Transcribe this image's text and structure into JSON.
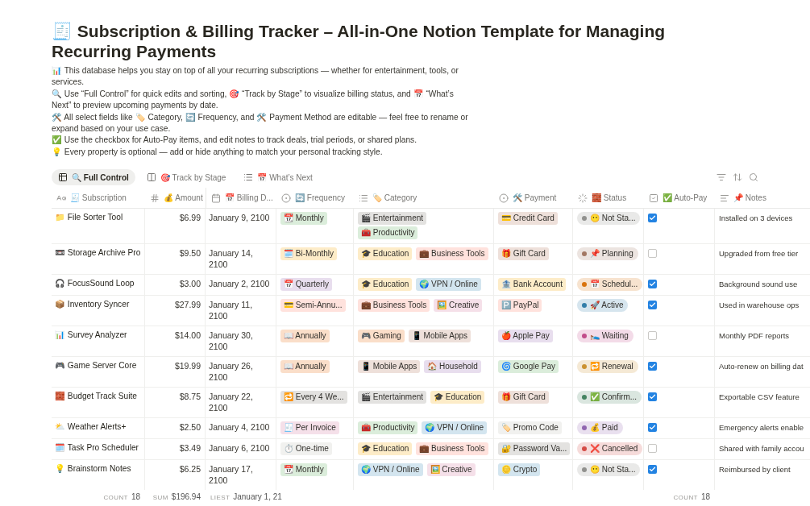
{
  "title": "🧾 Subscription & Billing Tracker – All-in-One Notion Template for Managing Recurring Payments",
  "description": [
    "📊 This database helps you stay on top of all your recurring subscriptions — whether for entertainment, tools, or services.",
    "🔍 Use “Full Control” for quick edits and sorting, 🎯 “Track by Stage” to visualize billing status, and 📅 “What’s Next” to preview upcoming payments by date.",
    "🛠️ All select fields like 🏷️ Category, 🔄 Frequency, and 🛠️ Payment Method are editable — feel free to rename or expand based on your use case.",
    "✅ Use the checkbox for Auto-Pay items, and edit notes to track deals, trial periods, or shared plans.",
    "💡 Every property is optional — add or hide anything to match your personal tracking style."
  ],
  "views": [
    {
      "kind": "table",
      "label": "🔍 Full Control",
      "selected": true
    },
    {
      "kind": "board",
      "label": "🎯 Track by Stage",
      "selected": false
    },
    {
      "kind": "list",
      "label": "📅 What’s Next",
      "selected": false
    }
  ],
  "columns": [
    {
      "kind": "text",
      "label": "🧾 Subscription"
    },
    {
      "kind": "number",
      "label": "💰 Amount"
    },
    {
      "kind": "date",
      "label": "📅 Billing D..."
    },
    {
      "kind": "select",
      "label": "🔄 Frequency"
    },
    {
      "kind": "multi",
      "label": "🏷️ Category"
    },
    {
      "kind": "select",
      "label": "🛠️ Payment"
    },
    {
      "kind": "status",
      "label": "🧱 Status"
    },
    {
      "kind": "checkbox",
      "label": "✅ Auto-Pay"
    },
    {
      "kind": "notes",
      "label": "📌 Notes"
    }
  ],
  "rows": [
    {
      "name": "📁 File Sorter Tool",
      "amount": "$6.99",
      "billing": "January 9, 2100",
      "frequency": {
        "label": "📆 Monthly",
        "color": "#dbeddb"
      },
      "categories": [
        {
          "label": "🎬 Entertainment",
          "color": "#e3e2e0"
        },
        {
          "label": "🧰 Productivity",
          "color": "#dbeddb"
        }
      ],
      "payment": {
        "label": "💳 Credit Card",
        "color": "#eee0da"
      },
      "status": {
        "label": "😶 Not Sta...",
        "color": "#91918e"
      },
      "auto_pay": true,
      "notes": "Installed on 3 devices"
    },
    {
      "name": "📼 Storage Archive Pro",
      "amount": "$9.50",
      "billing": "January 14, 2100",
      "frequency": {
        "label": "🗓️ Bi-Monthly",
        "color": "#fdecc8"
      },
      "categories": [
        {
          "label": "🎓 Education",
          "color": "#fdecc8"
        },
        {
          "label": "💼 Business Tools",
          "color": "#ffe2dd"
        }
      ],
      "payment": {
        "label": "🎁 Gift Card",
        "color": "#eee0da"
      },
      "status": {
        "label": "📌 Planning",
        "color": "#a27763"
      },
      "auto_pay": false,
      "notes": "Upgraded from free tier"
    },
    {
      "name": "🎧 FocusSound Loop",
      "amount": "$3.00",
      "billing": "January 2, 2100",
      "frequency": {
        "label": "📅 Quarterly",
        "color": "#e8deee"
      },
      "categories": [
        {
          "label": "🎓 Education",
          "color": "#fdecc8"
        },
        {
          "label": "🌍 VPN / Online",
          "color": "#d3e5ef"
        }
      ],
      "payment": {
        "label": "🏦 Bank Account",
        "color": "#fdecc8"
      },
      "status": {
        "label": "📅 Schedul...",
        "color": "#d9730d"
      },
      "auto_pay": true,
      "notes": "Background sound use"
    },
    {
      "name": "📦 Inventory Syncer",
      "amount": "$27.99",
      "billing": "January 11, 2100",
      "frequency": {
        "label": "💳 Semi-Annu...",
        "color": "#ffe2dd"
      },
      "categories": [
        {
          "label": "💼 Business Tools",
          "color": "#ffe2dd"
        },
        {
          "label": "🖼️ Creative",
          "color": "#f5e0e9"
        }
      ],
      "payment": {
        "label": "🅿️ PayPal",
        "color": "#ffe2dd"
      },
      "status": {
        "label": "🚀 Active",
        "color": "#337ea9"
      },
      "auto_pay": true,
      "notes": "Used in warehouse ops"
    },
    {
      "name": "📊 Survey Analyzer",
      "amount": "$14.00",
      "billing": "January 30, 2100",
      "frequency": {
        "label": "📖 Annually",
        "color": "#fadec9"
      },
      "categories": [
        {
          "label": "🎮 Gaming",
          "color": "#fadec9"
        },
        {
          "label": "📱 Mobile Apps",
          "color": "#eee0da"
        }
      ],
      "payment": {
        "label": "🍎 Apple Pay",
        "color": "#e8deee"
      },
      "status": {
        "label": "🛌 Waiting",
        "color": "#c14c8a"
      },
      "auto_pay": false,
      "notes": "Monthly PDF reports"
    },
    {
      "name": "🎮 Game Server Core",
      "amount": "$19.99",
      "billing": "January 26, 2100",
      "frequency": {
        "label": "📖 Annually",
        "color": "#fadec9"
      },
      "categories": [
        {
          "label": "📱 Mobile Apps",
          "color": "#eee0da"
        },
        {
          "label": "🏠 Household",
          "color": "#e8deee"
        }
      ],
      "payment": {
        "label": "🌀 Google Pay",
        "color": "#dbeddb"
      },
      "status": {
        "label": "🔁 Renewal",
        "color": "#cb912f"
      },
      "auto_pay": true,
      "notes": "Auto-renew on billing dat"
    },
    {
      "name": "🧱 Budget Track Suite",
      "amount": "$8.75",
      "billing": "January 22, 2100",
      "frequency": {
        "label": "🔁 Every 4 We...",
        "color": "#e3e2e0"
      },
      "categories": [
        {
          "label": "🎬 Entertainment",
          "color": "#e3e2e0"
        },
        {
          "label": "🎓 Education",
          "color": "#fdecc8"
        }
      ],
      "payment": {
        "label": "🎁 Gift Card",
        "color": "#eee0da"
      },
      "status": {
        "label": "✅ Confirm...",
        "color": "#448361"
      },
      "auto_pay": true,
      "notes": "Exportable CSV feature"
    },
    {
      "name": "⛅ Weather Alerts+",
      "amount": "$2.50",
      "billing": "January 4, 2100",
      "frequency": {
        "label": "🧾 Per Invoice",
        "color": "#f5e0e9"
      },
      "categories": [
        {
          "label": "🧰 Productivity",
          "color": "#dbeddb"
        },
        {
          "label": "🌍 VPN / Online",
          "color": "#d3e5ef"
        }
      ],
      "payment": {
        "label": "🏷️ Promo Code",
        "color": "#f1f1ef"
      },
      "status": {
        "label": "💰 Paid",
        "color": "#9065b0"
      },
      "auto_pay": true,
      "notes": "Emergency alerts enable"
    },
    {
      "name": "🗓️ Task Pro Scheduler",
      "amount": "$3.49",
      "billing": "January 6, 2100",
      "frequency": {
        "label": "⏱️ One-time",
        "color": "#f1f1ef"
      },
      "categories": [
        {
          "label": "🎓 Education",
          "color": "#fdecc8"
        },
        {
          "label": "💼 Business Tools",
          "color": "#ffe2dd"
        }
      ],
      "payment": {
        "label": "🔐 Password Va...",
        "color": "#e3e2e0"
      },
      "status": {
        "label": "❌ Cancelled",
        "color": "#d44c47"
      },
      "auto_pay": false,
      "notes": "Shared with family accou"
    },
    {
      "name": "💡 Brainstorm Notes",
      "amount": "$6.25",
      "billing": "January 17, 2100",
      "frequency": {
        "label": "📆 Monthly",
        "color": "#dbeddb"
      },
      "categories": [
        {
          "label": "🌍 VPN / Online",
          "color": "#d3e5ef"
        },
        {
          "label": "🖼️ Creative",
          "color": "#f5e0e9"
        }
      ],
      "payment": {
        "label": "🪙 Crypto",
        "color": "#d3e5ef"
      },
      "status": {
        "label": "😶 Not Sta...",
        "color": "#91918e"
      },
      "auto_pay": true,
      "notes": "Reimbursed by client"
    }
  ],
  "footer": {
    "subscription": {
      "label": "COUNT",
      "value": "18"
    },
    "amount": {
      "label": "SUM",
      "value": "$196.94"
    },
    "billing": {
      "label": "LIEST",
      "value": "January 1, 21"
    },
    "auto_pay": {
      "label": "COUNT",
      "value": "18"
    }
  }
}
